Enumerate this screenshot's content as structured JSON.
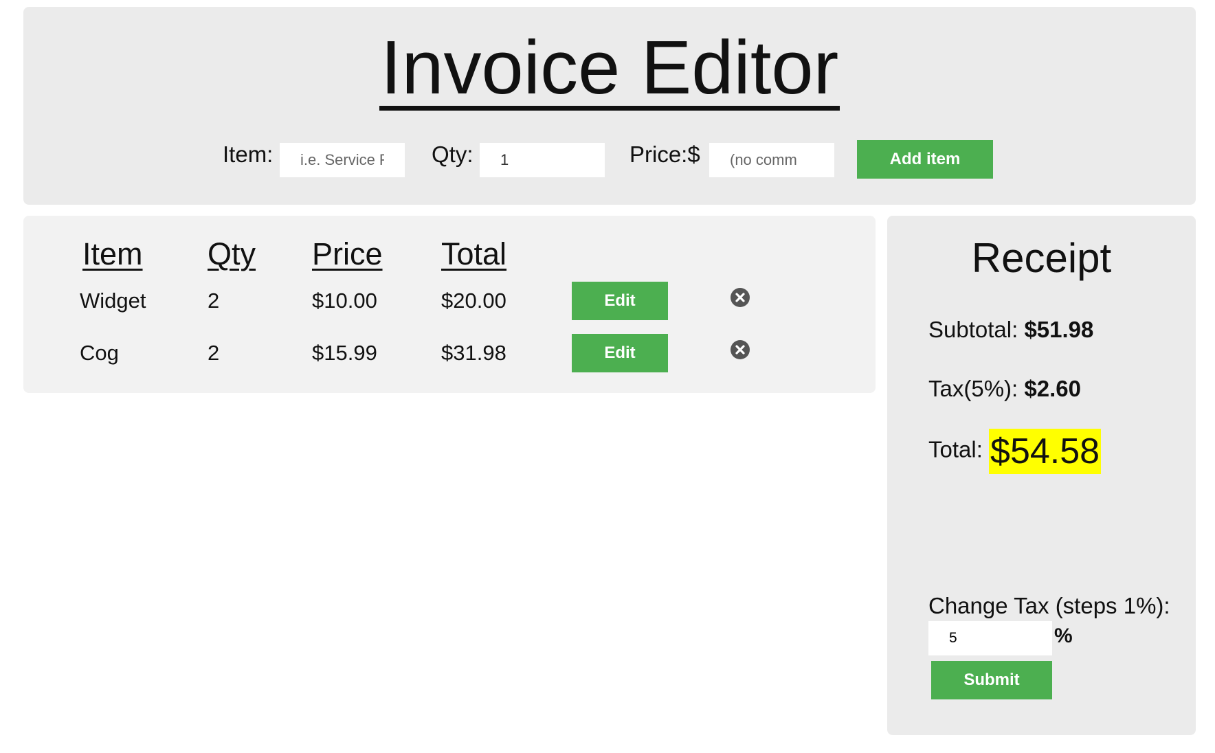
{
  "header": {
    "title": "Invoice Editor",
    "form": {
      "item_label": "Item:",
      "item_placeholder": "i.e. Service F",
      "qty_label": "Qty:",
      "qty_value": "1",
      "price_label": "Price:$",
      "price_placeholder": "(no comm",
      "add_button_label": "Add item"
    }
  },
  "items_table": {
    "columns": [
      "Item",
      "Qty",
      "Price",
      "Total"
    ],
    "rows": [
      {
        "item": "Widget",
        "qty": "2",
        "price": "$10.00",
        "total": "$20.00",
        "edit_label": "Edit"
      },
      {
        "item": "Cog",
        "qty": "2",
        "price": "$15.99",
        "total": "$31.98",
        "edit_label": "Edit"
      }
    ],
    "delete_icon": "close-circle-icon"
  },
  "receipt": {
    "title": "Receipt",
    "subtotal_label": "Subtotal:",
    "subtotal_value": "$51.98",
    "tax_label": "Tax(5%):",
    "tax_value": "$2.60",
    "total_label": "Total:",
    "total_value": "$54.58",
    "change_tax_label": "Change Tax (steps 1%):",
    "tax_input_value": "5",
    "percent_sign": "%",
    "submit_label": "Submit"
  },
  "colors": {
    "accent_green": "#4caf50",
    "highlight_yellow": "#ffff00",
    "panel_gray": "#ebebeb"
  }
}
